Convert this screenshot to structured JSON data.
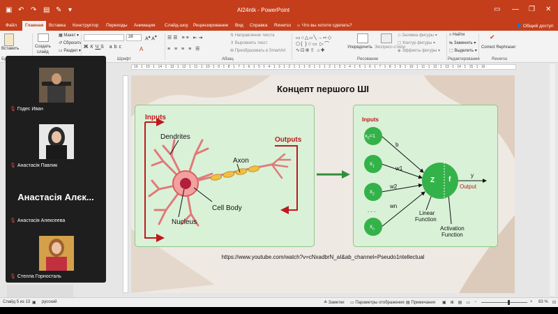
{
  "titlebar": {
    "title": "AI24ntk  -  PowerPoint",
    "qa_icons": [
      "save-icon",
      "undo-icon",
      "redo-icon",
      "present-icon",
      "format-painter-icon",
      "qa-customize-icon"
    ]
  },
  "tabs": [
    "Файл",
    "Главная",
    "Вставка",
    "Конструктор",
    "Переходы",
    "Анимация",
    "Слайд-шоу",
    "Рецензирование",
    "Вид",
    "Справка",
    "Reverso"
  ],
  "active_tab": "Главная",
  "tellme": "Что вы хотите сделать?",
  "share": "Общий доступ",
  "ribbon": {
    "paste": "Вставить",
    "new_slide_1": "Создать",
    "new_slide_2": "слайд",
    "layout": "Макет",
    "reset": "Сбросить",
    "section": "Раздел",
    "font_name": "",
    "font_size": "28",
    "text_direction": "Направление текста",
    "align_text": "Выровнять текст",
    "smartart": "Преобразовать в SmartArt",
    "arrange": "Упорядочить",
    "quick_styles": "Экспресс-стили",
    "shape_fill": "Заливка фигуры",
    "shape_outline": "Контур фигуры",
    "shape_effects": "Эффекты фигуры",
    "find": "Найти",
    "replace": "Заменить",
    "select": "Выделить",
    "correct": "Correct Rephraser",
    "group_labels": {
      "clipboard": "Бу",
      "font": "Шрифт",
      "paragraph": "Абзац",
      "drawing": "Рисование",
      "editing": "Редактирование",
      "reverso": "Reverso"
    }
  },
  "ruler_text": "· 16 · 1 · 15 · 1 · 14 · 1 · 13 · 1 · 12 · 1 · 11 · 1 · 10 · 1 · 9 · 1 · 8 · 1 · 7 · 1 · 6 · 1 · 5 · 1 · 4 · 1 · 3 · 1 · 2 · 1 · 1 · 1 · 0 · 1 · 1 · 1 · 2 · 1 · 3 · 1 · 4 · 1 · 5 · 1 · 6 · 1 · 7 · 1 · 8 · 1 · 9 · 1 · 10 · 1 · 11 · 1 · 12 · 1 · 13 · 1 · 14 · 1 · 15 · 1 · 16 ·",
  "slide": {
    "title": "Концепт першого ШІ",
    "link": "https://www.youtube.com/watch?v=cNxadbrN_aI&ab_channel=Pseudo1ntellectual",
    "left": {
      "inputs": "Inputs",
      "outputs": "Outputs",
      "dendrites": "Dendrites",
      "axon": "Axon",
      "cell_body": "Cell Body",
      "nucleus": "Nucleus"
    },
    "right": {
      "inputs": "Inputs",
      "x0": "x",
      "x0_sub": "0",
      "x0_eq": "=1",
      "x1": "x",
      "x1_sub": "1",
      "x2": "x",
      "x2_sub": "2",
      "dots": ". . .",
      "xn": "x",
      "xn_sub": "n",
      "b": "b",
      "w1": "w1",
      "w2": "w2",
      "wn": "wn",
      "z": "Z",
      "f": "f",
      "y": "y",
      "output": "Output",
      "linear": "Linear",
      "function1": "Function",
      "activation": "Activation",
      "function2": "Function"
    }
  },
  "participants": [
    {
      "name": "Годес Иван"
    },
    {
      "name": "Анастасія Павлик"
    },
    {
      "name": "Анастасія Алексеева",
      "big": "Анастасія Алєк..."
    },
    {
      "name": "Стелла Горносталь"
    }
  ],
  "status": {
    "slide": "Слайд 5 из 13",
    "lang": "русский",
    "notes": "Заметки",
    "display": "Параметры отображения",
    "comments": "Примечания",
    "zoom": "83 %"
  },
  "colors": {
    "accent": "#c43e1c",
    "green_panel": "#d9f1d7",
    "green_node": "#34b24a",
    "red_arrow": "#c0181c"
  }
}
